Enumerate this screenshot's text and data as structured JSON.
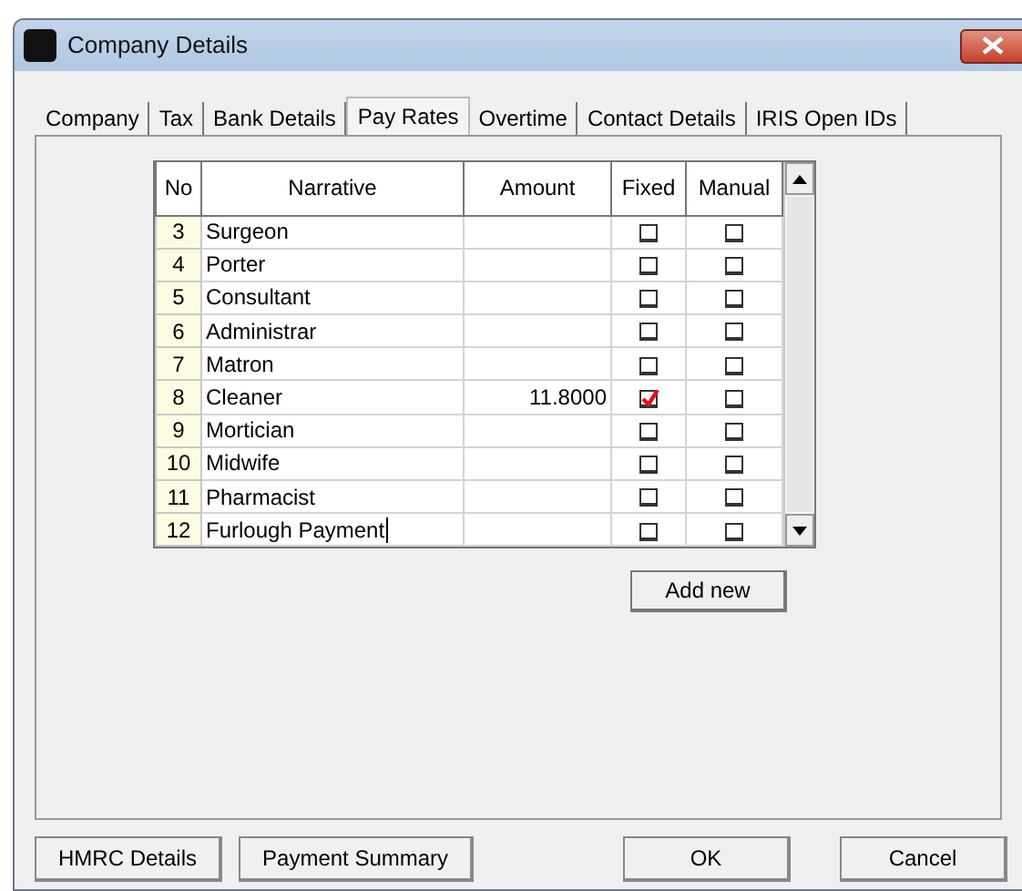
{
  "window": {
    "title": "Company Details"
  },
  "tabs": [
    {
      "label": "Company",
      "selected": false
    },
    {
      "label": "Tax",
      "selected": false
    },
    {
      "label": "Bank Details",
      "selected": false
    },
    {
      "label": "Pay Rates",
      "selected": true
    },
    {
      "label": "Overtime",
      "selected": false
    },
    {
      "label": "Contact Details",
      "selected": false
    },
    {
      "label": "IRIS Open IDs",
      "selected": false
    }
  ],
  "table": {
    "columns": [
      "No",
      "Narrative",
      "Amount",
      "Fixed",
      "Manual"
    ],
    "rows": [
      {
        "no": "3",
        "narrative": "Surgeon",
        "fixed": false,
        "manual": false,
        "editing": false
      },
      {
        "no": "4",
        "narrative": "Porter",
        "fixed": false,
        "manual": false,
        "editing": false
      },
      {
        "no": "5",
        "narrative": "Consultant",
        "fixed": false,
        "manual": false,
        "editing": false
      },
      {
        "no": "6",
        "narrative": "Administrar",
        "fixed": false,
        "manual": false,
        "editing": false
      },
      {
        "no": "7",
        "narrative": "Matron",
        "fixed": false,
        "manual": false,
        "editing": false
      },
      {
        "no": "8",
        "narrative": "Cleaner",
        "amount": "11.8000",
        "fixed": true,
        "manual": false,
        "editing": false
      },
      {
        "no": "9",
        "narrative": "Mortician",
        "fixed": false,
        "manual": false,
        "editing": false
      },
      {
        "no": "10",
        "narrative": "Midwife",
        "fixed": false,
        "manual": false,
        "editing": false
      },
      {
        "no": "11",
        "narrative": "Pharmacist",
        "fixed": false,
        "manual": false,
        "editing": false
      },
      {
        "no": "12",
        "narrative": "Furlough Payment",
        "fixed": false,
        "manual": false,
        "editing": true
      }
    ]
  },
  "add_button": "Add new",
  "footer_buttons": [
    {
      "label": "HMRC Details",
      "kind": "left"
    },
    {
      "label": "Payment Summary",
      "kind": "left"
    },
    {
      "label": "OK",
      "kind": "right"
    },
    {
      "label": "Cancel",
      "kind": "right"
    }
  ]
}
